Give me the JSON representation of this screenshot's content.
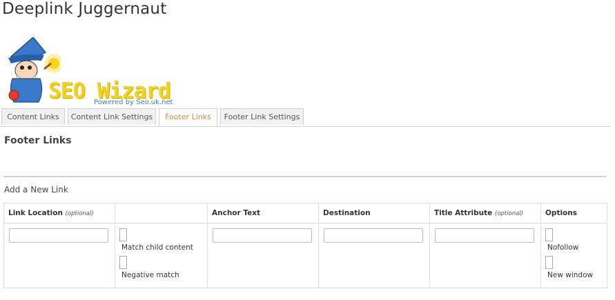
{
  "app": {
    "title": "Deeplink Juggernaut"
  },
  "logo": {
    "text": "SEO Wizard",
    "tagline": "Powered by Seo.uk.net"
  },
  "tabs": [
    {
      "label": "Content Links",
      "active": false
    },
    {
      "label": "Content Link Settings",
      "active": false
    },
    {
      "label": "Footer Links",
      "active": true
    },
    {
      "label": "Footer Link Settings",
      "active": false
    }
  ],
  "section": {
    "title": "Footer Links",
    "add_label": "Add a New Link"
  },
  "table": {
    "headers": [
      {
        "label": "Link Location",
        "note": "(optional)"
      },
      {
        "label": "",
        "note": ""
      },
      {
        "label": "Anchor Text",
        "note": ""
      },
      {
        "label": "Destination",
        "note": ""
      },
      {
        "label": "Title Attribute",
        "note": "(optional)"
      },
      {
        "label": "Options",
        "note": ""
      }
    ],
    "link_location_value": "",
    "anchor_text_value": "",
    "destination_value": "",
    "title_attribute_value": "",
    "match_options": [
      {
        "label": "Match child content",
        "checked": false
      },
      {
        "label": "Negative match",
        "checked": false
      }
    ],
    "link_options": [
      {
        "label": "Nofollow",
        "checked": false
      },
      {
        "label": "New window",
        "checked": false
      }
    ]
  },
  "colors": {
    "active_tab": "#d08a3c",
    "logo_yellow": "#f5d21b",
    "logo_blue": "#3a7ecf"
  }
}
